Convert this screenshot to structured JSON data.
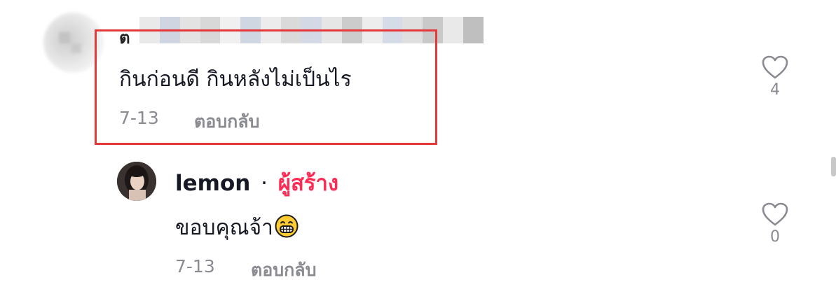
{
  "comment1": {
    "username_partial": "ต",
    "text": "กินก่อนดี กินหลังไม่เป็นไร",
    "date": "7-13",
    "reply_label": "ตอบกลับ",
    "like_count": "4"
  },
  "comment2": {
    "username": "lemon",
    "separator": "·",
    "creator_badge": "ผู้สร้าง",
    "text": "ขอบคุณจ้า",
    "emoji": "grinning-face-icon",
    "date": "7-13",
    "reply_label": "ตอบกลับ",
    "like_count": "0"
  },
  "colors": {
    "highlight_border": "#e23a3a",
    "creator_badge": "#fe2c55",
    "meta_text": "#8a8b91",
    "main_text": "#161823"
  }
}
